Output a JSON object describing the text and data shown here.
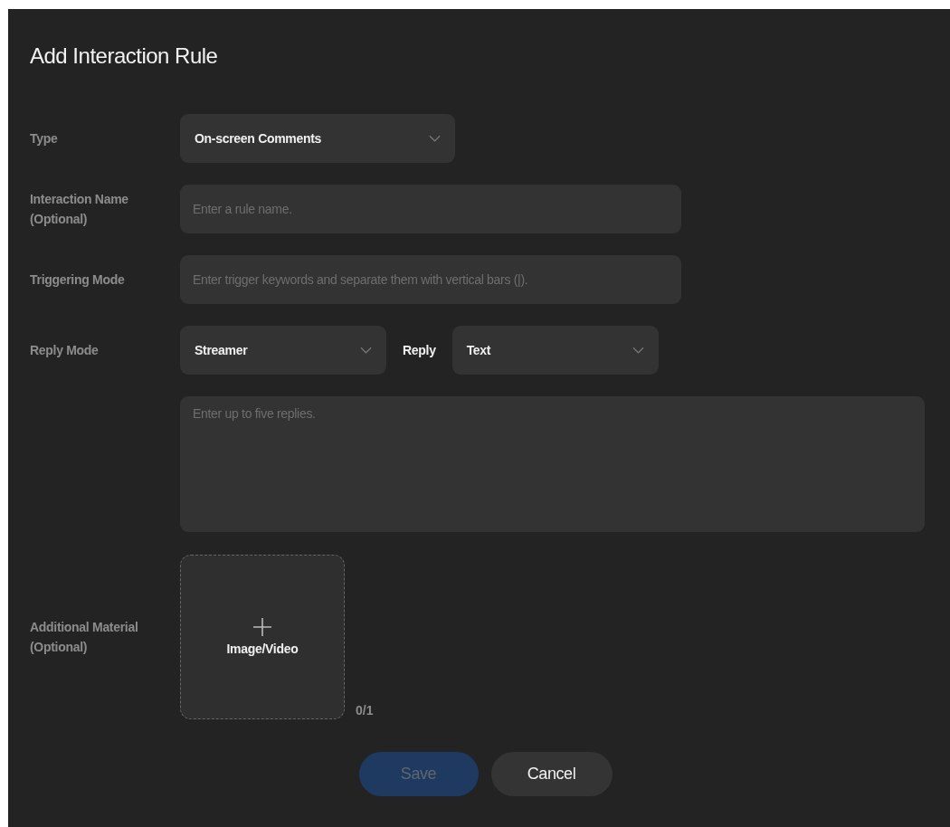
{
  "title": "Add Interaction Rule",
  "rows": [
    {
      "kind": "select",
      "label": "Type",
      "value": "On-screen Comments"
    },
    {
      "kind": "input",
      "label": "Interaction Name (Optional)",
      "placeholder": "Enter a rule name."
    },
    {
      "kind": "input",
      "label": "Triggering Mode",
      "placeholder": "Enter trigger keywords and separate them with vertical bars (|)."
    },
    {
      "kind": "pair",
      "label": "Reply Mode",
      "value": "Streamer",
      "second_label": "Reply",
      "second_value": "Text"
    },
    {
      "kind": "textarea",
      "placeholder": "Enter up to five replies."
    },
    {
      "kind": "upload",
      "label": "Additional Material (Optional)",
      "button": "Image/Video",
      "count": "0/1"
    }
  ],
  "buttons": [
    {
      "label": "Save",
      "kind": "primary",
      "disabled": true
    },
    {
      "label": "Cancel",
      "kind": "secondary",
      "disabled": false
    }
  ]
}
